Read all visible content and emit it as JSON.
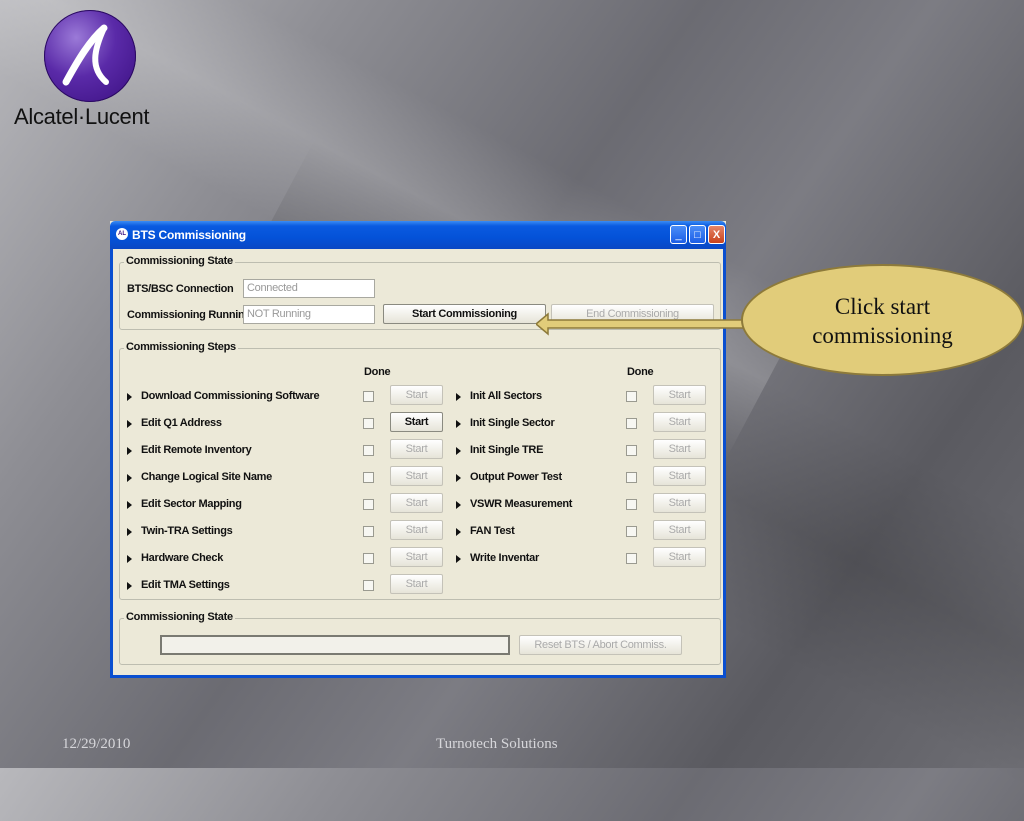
{
  "logo": {
    "text": "Alcatel·Lucent"
  },
  "window": {
    "title": "BTS Commissioning",
    "title_icon": "AL",
    "controls": {
      "minimize": "_",
      "maximize": "□",
      "close": "X"
    }
  },
  "state": {
    "legend": "Commissioning State",
    "bts_label": "BTS/BSC Connection",
    "bts_value": "Connected",
    "running_label": "Commissioning Running",
    "running_value": "NOT Running",
    "start_button": "Start Commissioning",
    "end_button": "End Commissioning"
  },
  "steps": {
    "legend": "Commissioning Steps",
    "done_header": "Done",
    "left": [
      {
        "label": "Download Commissioning Software",
        "button": "Start",
        "enabled": false
      },
      {
        "label": "Edit Q1 Address",
        "button": "Start",
        "enabled": true
      },
      {
        "label": "Edit Remote Inventory",
        "button": "Start",
        "enabled": false
      },
      {
        "label": "Change Logical Site Name",
        "button": "Start",
        "enabled": false
      },
      {
        "label": "Edit Sector Mapping",
        "button": "Start",
        "enabled": false
      },
      {
        "label": "Twin-TRA Settings",
        "button": "Start",
        "enabled": false
      },
      {
        "label": "Hardware Check",
        "button": "Start",
        "enabled": false
      },
      {
        "label": "Edit TMA Settings",
        "button": "Start",
        "enabled": false
      }
    ],
    "right": [
      {
        "label": "Init All Sectors",
        "button": "Start",
        "enabled": false
      },
      {
        "label": "Init Single Sector",
        "button": "Start",
        "enabled": false
      },
      {
        "label": "Init Single TRE",
        "button": "Start",
        "enabled": false
      },
      {
        "label": "Output Power Test",
        "button": "Start",
        "enabled": false
      },
      {
        "label": "VSWR Measurement",
        "button": "Start",
        "enabled": false
      },
      {
        "label": "FAN Test",
        "button": "Start",
        "enabled": false
      },
      {
        "label": "Write Inventar",
        "button": "Start",
        "enabled": false
      }
    ]
  },
  "bottom": {
    "legend": "Commissioning State",
    "reset_button": "Reset BTS / Abort Commiss."
  },
  "callout": {
    "line1": "Click start",
    "line2": "commissioning",
    "color": "#e1cc7a"
  },
  "footer": {
    "date": "12/29/2010",
    "company": "Turnotech Solutions"
  }
}
